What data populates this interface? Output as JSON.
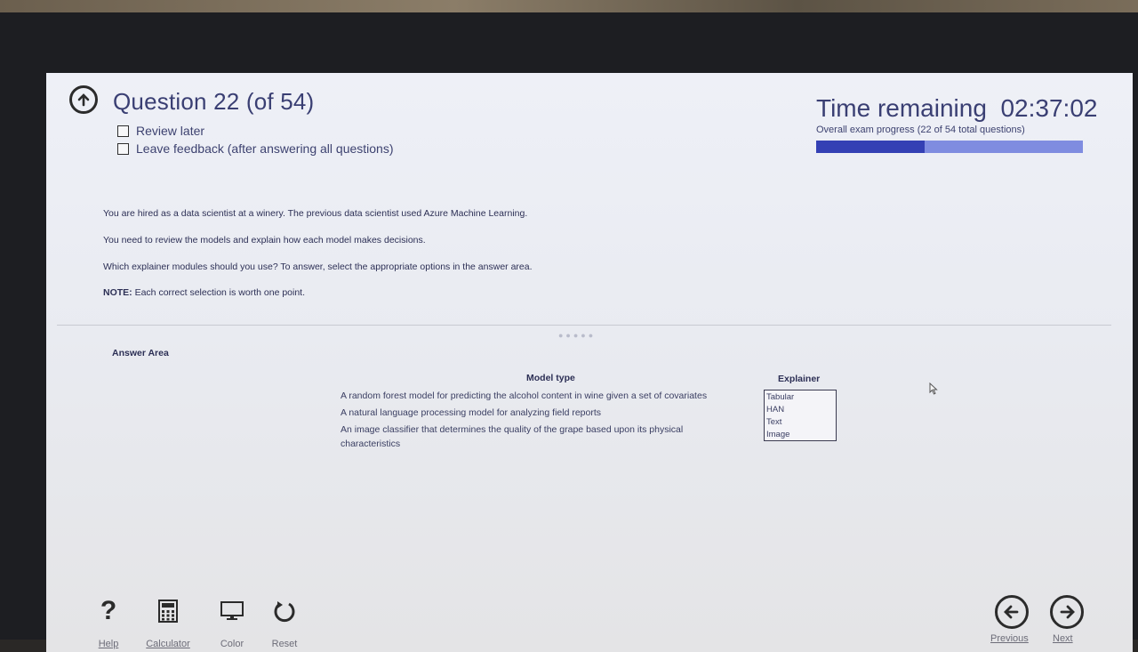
{
  "header": {
    "title": "Question 22 (of 54)",
    "review_later": "Review later",
    "leave_feedback": "Leave feedback (after answering all questions)",
    "time_remaining": "Time remaining  02:37:02",
    "progress_text": "Overall exam progress (22 of 54 total questions)",
    "progress_fraction": 0.407
  },
  "question": {
    "p1": "You are hired as a data scientist at a winery. The previous data scientist used Azure Machine Learning.",
    "p2": "You need to review the models and explain how each model makes decisions.",
    "p3": "Which explainer modules should you use? To answer, select the appropriate options in the answer area.",
    "note_label": "NOTE:",
    "note_text": " Each correct selection is worth one point."
  },
  "answer": {
    "title": "Answer Area",
    "model_type_header": "Model type",
    "explainer_header": "Explainer",
    "models": [
      "A random forest model for predicting the alcohol content in wine given a set of covariates",
      "A natural language processing model for analyzing field reports",
      "An image classifier that determines the quality of the grape based upon its physical characteristics"
    ],
    "options": [
      "Tabular",
      "HAN",
      "Text",
      "Image"
    ]
  },
  "footer": {
    "help": "Help",
    "calculator": "Calculator",
    "color": "Color",
    "reset": "Reset",
    "previous": "Previous",
    "next": "Next"
  },
  "colors": {
    "title_text": "#3a3f73",
    "progress_fill": "#3440b4",
    "progress_track": "#7f8ce0"
  }
}
